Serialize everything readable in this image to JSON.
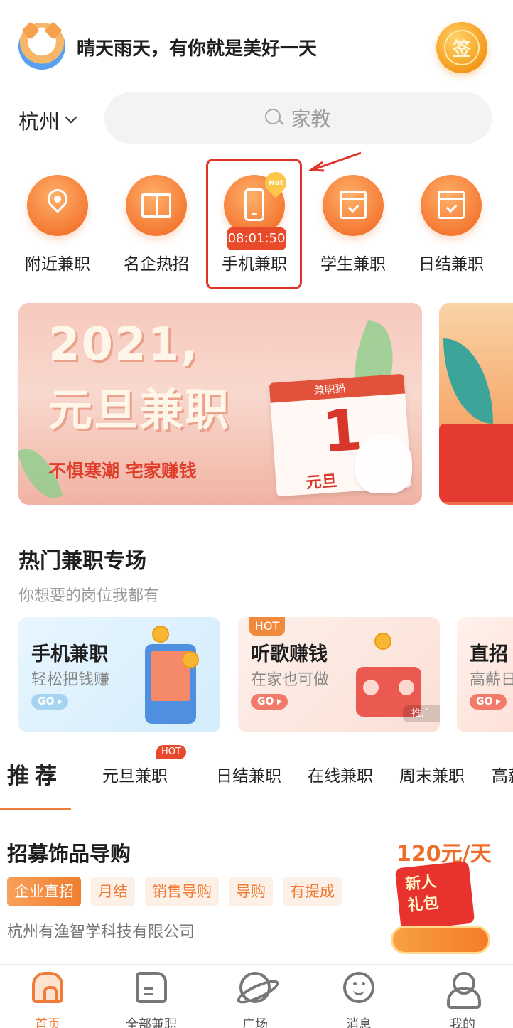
{
  "header": {
    "greeting": "晴天雨天，有你就是美好一天",
    "sign_label": "签"
  },
  "search": {
    "city": "杭州",
    "placeholder": "家教"
  },
  "categories": [
    {
      "label": "附近兼职",
      "icon": "location-pin-icon"
    },
    {
      "label": "名企热招",
      "icon": "book-icon"
    },
    {
      "label": "手机兼职",
      "icon": "phone-icon",
      "badge": "Hot",
      "timer": "08:01:50"
    },
    {
      "label": "学生兼职",
      "icon": "calendar-check-icon"
    },
    {
      "label": "日结兼职",
      "icon": "calendar-check-icon"
    }
  ],
  "banner": {
    "title_line1": "2021,",
    "title_line2": "元旦兼职",
    "subtitle": "不惧寒潮 宅家赚钱",
    "calendar_brand": "兼职猫",
    "calendar_number": "1",
    "calendar_holiday": "元旦"
  },
  "hot_section": {
    "title": "热门兼职专场",
    "subtitle": "你想要的岗位我都有",
    "cards": [
      {
        "title": "手机兼职",
        "subtitle": "轻松把钱赚",
        "go": "GO"
      },
      {
        "title": "听歌赚钱",
        "subtitle": "在家也可做",
        "go": "GO",
        "tag": "HOT",
        "ad": "推广"
      },
      {
        "title": "直招",
        "subtitle": "高薪日",
        "go": "GO"
      }
    ]
  },
  "tabs": {
    "active": "推荐",
    "items": [
      "元旦兼职",
      "日结兼职",
      "在线兼职",
      "周末兼职",
      "高薪"
    ],
    "hot_badge": "HOT"
  },
  "job": {
    "title": "招募饰品导购",
    "tags": [
      "企业直招",
      "月结",
      "销售导购",
      "导购",
      "有提成"
    ],
    "company": "杭州有渔智学科技有限公司",
    "salary": "120元/天",
    "promo_line1": "新人",
    "promo_line2": "礼包"
  },
  "bottom_nav": [
    {
      "label": "首页",
      "icon": "home-icon",
      "active": true
    },
    {
      "label": "全部兼职",
      "icon": "document-icon"
    },
    {
      "label": "广场",
      "icon": "planet-icon"
    },
    {
      "label": "消息",
      "icon": "message-icon"
    },
    {
      "label": "我的",
      "icon": "user-icon"
    }
  ],
  "colors": {
    "accent": "#f07c3c",
    "highlight_box": "#e0342a",
    "timer_bg": "#e84a2a"
  }
}
